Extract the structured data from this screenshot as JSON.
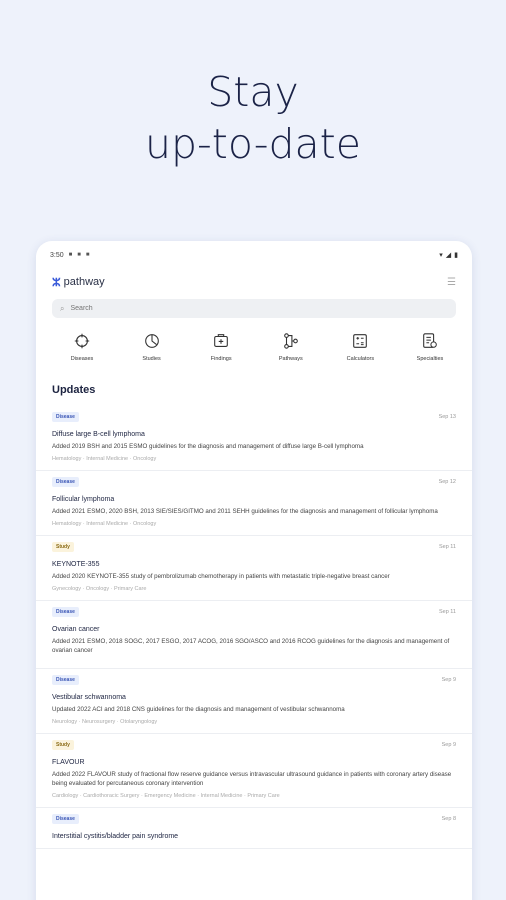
{
  "headline": {
    "line1": "Stay",
    "line2": "up-to-date"
  },
  "status": {
    "time": "3:50"
  },
  "app": {
    "name": "pathway"
  },
  "search": {
    "placeholder": "Search"
  },
  "categories": [
    {
      "label": "Diseases",
      "icon": "diseases-icon"
    },
    {
      "label": "Studies",
      "icon": "studies-icon"
    },
    {
      "label": "Findings",
      "icon": "findings-icon"
    },
    {
      "label": "Pathways",
      "icon": "pathways-icon"
    },
    {
      "label": "Calculators",
      "icon": "calculator-icon"
    },
    {
      "label": "Specialties",
      "icon": "specialties-icon"
    }
  ],
  "updates": {
    "title": "Updates",
    "items": [
      {
        "badge": "Disease",
        "date": "Sep 13",
        "title": "Diffuse large B-cell lymphoma",
        "desc": "Added 2019 BSH and 2015 ESMO guidelines for the diagnosis and management of diffuse large B-cell lymphoma",
        "tags": "Hematology · Internal Medicine · Oncology"
      },
      {
        "badge": "Disease",
        "date": "Sep 12",
        "title": "Follicular lymphoma",
        "desc": "Added 2021 ESMO, 2020 BSH, 2013 SIE/SIES/GITMO and 2011 SEHH guidelines for the diagnosis and management of follicular lymphoma",
        "tags": "Hematology · Internal Medicine · Oncology"
      },
      {
        "badge": "Study",
        "date": "Sep 11",
        "title": "KEYNOTE-355",
        "desc": "Added 2020 KEYNOTE-355 study of pembrolizumab chemotherapy in patients with metastatic triple-negative breast cancer",
        "tags": "Gynecology · Oncology · Primary Care"
      },
      {
        "badge": "Disease",
        "date": "Sep 11",
        "title": "Ovarian cancer",
        "desc": "Added 2021 ESMO, 2018 SOGC, 2017 ESGO, 2017 ACOG, 2016 SGO/ASCO and 2016 RCOG guidelines for the diagnosis and management of ovarian cancer",
        "tags": ""
      },
      {
        "badge": "Disease",
        "date": "Sep 9",
        "title": "Vestibular schwannoma",
        "desc": "Updated 2022 ACI and 2018 CNS guidelines for the diagnosis and management of vestibular schwannoma",
        "tags": "Neurology · Neurosurgery · Otolaryngology"
      },
      {
        "badge": "Study",
        "date": "Sep 9",
        "title": "FLAVOUR",
        "desc": "Added 2022 FLAVOUR study of fractional flow reserve guidance versus intravascular ultrasound guidance in patients with coronary artery disease being evaluated for percutaneous coronary intervention",
        "tags": "Cardiology · Cardiothoracic Surgery · Emergency Medicine · Internal Medicine · Primary Care"
      },
      {
        "badge": "Disease",
        "date": "Sep 8",
        "title": "Interstitial cystitis/bladder pain syndrome",
        "desc": "",
        "tags": ""
      }
    ]
  }
}
